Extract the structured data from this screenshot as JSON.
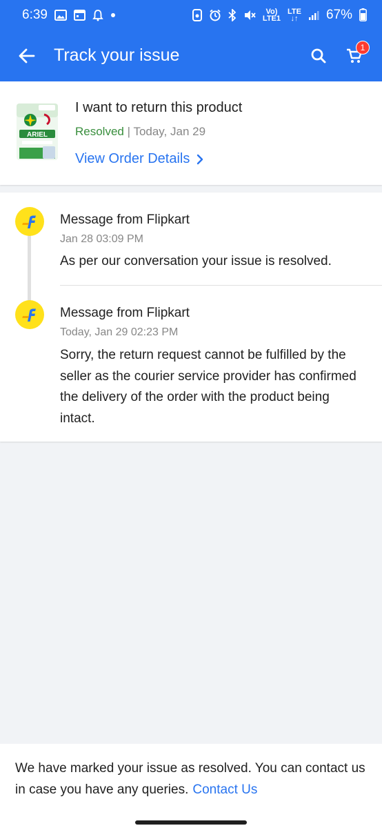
{
  "status_bar": {
    "time": "6:39",
    "network_top": "Vo)",
    "network_bottom": "LTE1",
    "lte_top": "LTE",
    "lte_bottom": "↓↑",
    "battery": "67%"
  },
  "app_bar": {
    "title": "Track your issue",
    "cart_count": "1"
  },
  "product": {
    "title": "I want to return this product",
    "status": "Resolved",
    "separator": " | ",
    "date": "Today, Jan 29",
    "link": "View Order Details",
    "brand_text": "ARIEL"
  },
  "messages": [
    {
      "from": "Message from Flipkart",
      "time": "Jan 28 03:09 PM",
      "body": "As per our conversation your issue is resolved."
    },
    {
      "from": "Message from Flipkart",
      "time": "Today, Jan 29 02:23 PM",
      "body": "Sorry, the return request cannot be fulfilled by the seller as the courier service provider has confirmed the delivery of the order with the product being intact."
    }
  ],
  "footer": {
    "text": "We have marked your issue as resolved. You can contact us in case you have any queries.",
    "link": "Contact Us"
  },
  "colors": {
    "primary": "#2874f0",
    "resolved": "#388e3c",
    "flipkart_yellow": "#ffe11b"
  }
}
